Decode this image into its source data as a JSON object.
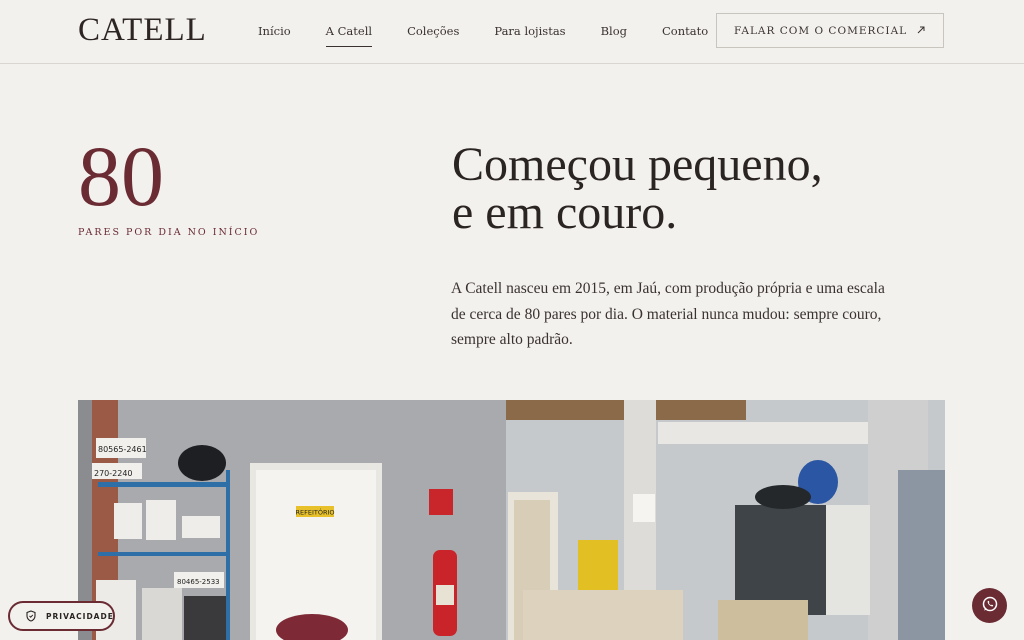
{
  "header": {
    "logo": "CATELL",
    "nav": [
      "Início",
      "A Catell",
      "Coleções",
      "Para lojistas",
      "Blog",
      "Contato"
    ],
    "active_nav": "A Catell",
    "cta_label": "FALAR COM O COMERCIAL",
    "cta_icon": "arrow-up-right-icon"
  },
  "hero": {
    "stat_value": "80",
    "stat_caption": "PARES POR DIA NO INÍCIO",
    "headline_line1": "Começou pequeno,",
    "headline_line2": "e em couro.",
    "paragraph": "A Catell nasceu em 2015, em Jaú, com produção própria e uma escala de cerca de 80 pares por dia. O material nunca mudou: sempre couro, sempre alto padrão."
  },
  "photo": {
    "sign_phone1": "80565-2461",
    "sign_phone2": "270-2240",
    "sign_refeitorio": "REFEITÓRIO",
    "box_label": "80465-2533"
  },
  "privacy": {
    "label": "PRIVACIDADE",
    "icon": "shield-icon"
  },
  "whatsapp": {
    "icon": "whatsapp-icon"
  },
  "colors": {
    "accent": "#6a2b33",
    "background": "#f2f1ee",
    "text": "#2a2423"
  }
}
